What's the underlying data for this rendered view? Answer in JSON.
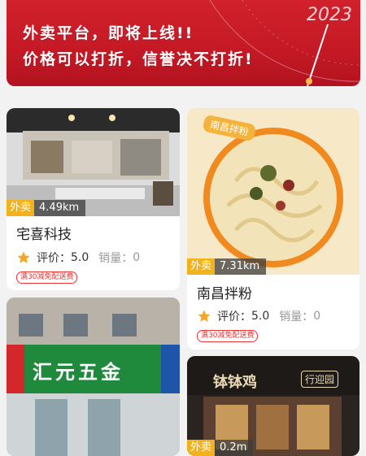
{
  "banner": {
    "line1": "外卖平台，即将上线!!",
    "line2": "价格可以打折，信誉决不打折!",
    "year": "2023"
  },
  "cards": [
    {
      "distance_tag": "外卖",
      "distance": "4.49km",
      "name": "宅喜科技",
      "rating_label": "评价：",
      "rating": "5.0",
      "sales_label": "销量：",
      "sales": "0",
      "promo": "满30减免配送费"
    },
    {
      "image_label": "南昌拌粉",
      "distance_tag": "外卖",
      "distance": "7.31km",
      "name": "南昌拌粉",
      "rating_label": "评价：",
      "rating": "5.0",
      "sales_label": "销量：",
      "sales": "0",
      "promo": "满30减免配送费"
    },
    {
      "sign": "汇元五金"
    },
    {
      "sign": "钵钵鸡",
      "sign_badge": "行迎园",
      "distance_tag": "外卖",
      "distance": "0.2m"
    }
  ],
  "colors": {
    "brand_red": "#c41925",
    "tag_yellow": "#f2b21b",
    "promo_red": "#ee3333"
  }
}
